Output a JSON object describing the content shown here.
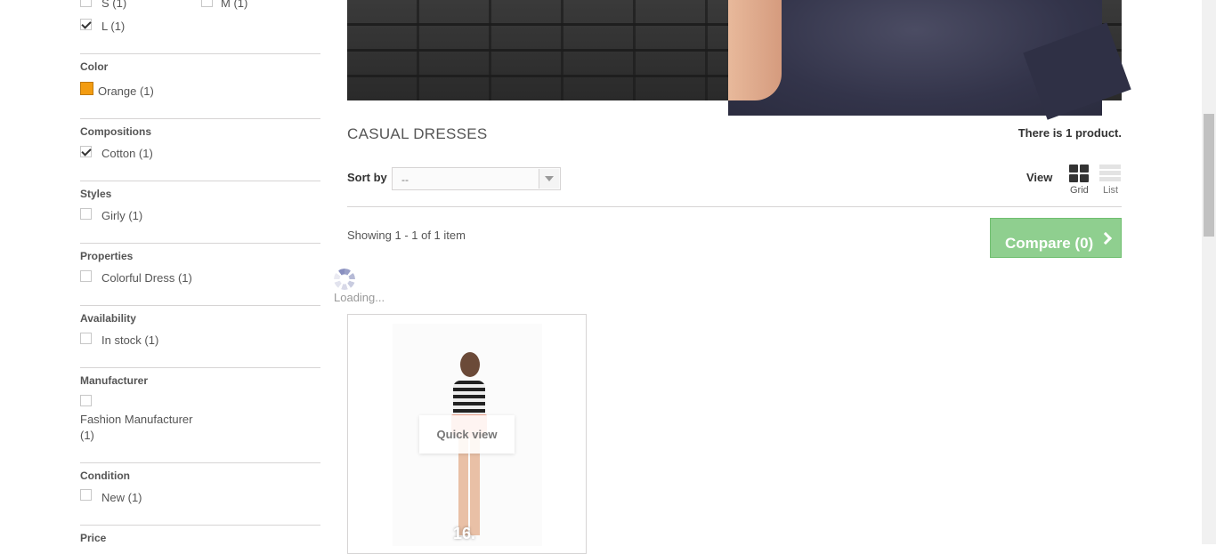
{
  "filters": {
    "size": {
      "options": [
        {
          "label": "S (1)",
          "checked": false
        },
        {
          "label": "M (1)",
          "checked": false
        },
        {
          "label": "L (1)",
          "checked": true
        }
      ]
    },
    "color": {
      "heading": "Color",
      "options": [
        {
          "label": "Orange (1)",
          "swatch": "#f39c11"
        }
      ]
    },
    "compositions": {
      "heading": "Compositions",
      "options": [
        {
          "label": "Cotton (1)",
          "checked": true
        }
      ]
    },
    "styles": {
      "heading": "Styles",
      "options": [
        {
          "label": "Girly (1)",
          "checked": false
        }
      ]
    },
    "properties": {
      "heading": "Properties",
      "options": [
        {
          "label": "Colorful Dress (1)",
          "checked": false
        }
      ]
    },
    "availability": {
      "heading": "Availability",
      "options": [
        {
          "label": "In stock (1)",
          "checked": false
        }
      ]
    },
    "manufacturer": {
      "heading": "Manufacturer",
      "options": [
        {
          "label_line1": "Fashion Manufacturer",
          "label_line2": "(1)",
          "checked": false
        }
      ]
    },
    "condition": {
      "heading": "Condition",
      "options": [
        {
          "label": "New (1)",
          "checked": false
        }
      ]
    },
    "price": {
      "heading": "Price"
    }
  },
  "main": {
    "heading": "Casual Dresses",
    "product_count": "There is 1 product.",
    "sort": {
      "label": "Sort by",
      "value": "--"
    },
    "view": {
      "label": "View",
      "grid_label": "Grid",
      "list_label": "List",
      "active": "grid"
    },
    "showing": "Showing 1 - 1 of 1 item",
    "compare_label": "Compare (0)",
    "loading_label": "Loading...",
    "product": {
      "quick_view_label": "Quick view",
      "price_peek": "16."
    }
  },
  "colors": {
    "accent_green": "#8fcf8f",
    "swatch_orange": "#f39c11"
  }
}
